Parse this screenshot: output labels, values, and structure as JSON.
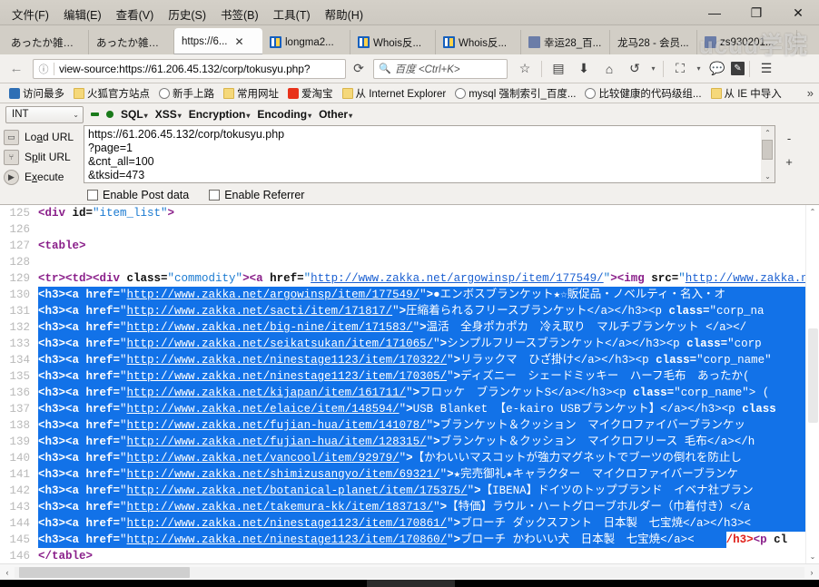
{
  "window": {
    "menu": [
      "文件(F)",
      "编辑(E)",
      "查看(V)",
      "历史(S)",
      "书签(B)",
      "工具(T)",
      "帮助(H)"
    ],
    "controls": {
      "minimize": "—",
      "maximize": "❐",
      "close": "✕"
    }
  },
  "tabs": [
    {
      "label": "あったか雑貨...",
      "favicon": "none",
      "active": false,
      "closable": false
    },
    {
      "label": "あったか雑貨...",
      "favicon": "none",
      "active": false,
      "closable": false
    },
    {
      "label": "https://6...",
      "favicon": "none",
      "active": true,
      "closable": true
    },
    {
      "label": "longma2...",
      "favicon": "blue",
      "active": false,
      "closable": false
    },
    {
      "label": "Whois反...",
      "favicon": "blue",
      "active": false,
      "closable": false
    },
    {
      "label": "Whois反...",
      "favicon": "blue",
      "active": false,
      "closable": false
    },
    {
      "label": "幸运28_百...",
      "favicon": "grey",
      "active": false,
      "closable": false
    },
    {
      "label": "龙马28 - 会员...",
      "favicon": "none",
      "active": false,
      "closable": false
    },
    {
      "label": "zs930201...",
      "favicon": "grey",
      "active": false,
      "closable": false
    }
  ],
  "nav": {
    "back_icon": "back-arrow-icon",
    "info_icon": "ⓘ",
    "url": "view-source:https://61.206.45.132/corp/tokusyu.php?",
    "reload_icon": "⟳",
    "search_placeholder": "百度 <Ctrl+K>",
    "icons": [
      "bookmark-star-icon",
      "reader-icon",
      "download-icon",
      "home-icon",
      "undo-icon",
      "screenshot-icon",
      "chat-icon",
      "edit-icon",
      "menu-icon"
    ]
  },
  "bookmarks": [
    {
      "label": "访问最多",
      "icon": "blue"
    },
    {
      "label": "火狐官方站点",
      "icon": "folder"
    },
    {
      "label": "新手上路",
      "icon": "globe"
    },
    {
      "label": "常用网址",
      "icon": "folder"
    },
    {
      "label": "爱淘宝",
      "icon": "red"
    },
    {
      "label": "从 Internet Explorer",
      "icon": "folder"
    },
    {
      "label": "mysql 强制索引_百度...",
      "icon": "globe"
    },
    {
      "label": "比较健康的代码级组...",
      "icon": "globe"
    },
    {
      "label": "从 IE 中导入",
      "icon": "folder"
    }
  ],
  "bookmarks_overflow": "»",
  "hackbar": {
    "select_value": "INT",
    "select_chevron": "⌄",
    "menus": [
      "SQL",
      "XSS",
      "Encryption",
      "Encoding",
      "Other"
    ],
    "menu_caret": "▾",
    "actions": [
      {
        "label_pre": "Lo",
        "label_key": "a",
        "label_post": "d URL",
        "icon": "load-url-icon"
      },
      {
        "label_pre": "S",
        "label_key": "p",
        "label_post": "lit URL",
        "icon": "split-url-icon"
      },
      {
        "label_pre": "E",
        "label_key": "x",
        "label_post": "ecute",
        "icon": "execute-icon"
      }
    ],
    "url_value": "https://61.206.45.132/corp/tokusyu.php\n?page=1\n&cnt_all=100\n&tksid=473",
    "checkbox_post": "Enable Post data",
    "checkbox_referrer": "Enable Referrer",
    "zoom_plus": "+",
    "zoom_minus": "-"
  },
  "source": {
    "lines": [
      {
        "n": "125",
        "selected": false,
        "parts": [
          {
            "c": "t",
            "s": "<div "
          },
          {
            "c": "a",
            "s": "id="
          },
          {
            "c": "v",
            "s": "\"item_list\""
          },
          {
            "c": "t",
            "s": ">"
          }
        ]
      },
      {
        "n": "126",
        "selected": false,
        "parts": []
      },
      {
        "n": "127",
        "selected": false,
        "parts": [
          {
            "c": "t",
            "s": "<table>"
          }
        ]
      },
      {
        "n": "128",
        "selected": false,
        "parts": []
      },
      {
        "n": "129",
        "selected": false,
        "parts": [
          {
            "c": "t",
            "s": "<tr><td><div "
          },
          {
            "c": "a",
            "s": "class="
          },
          {
            "c": "v",
            "s": "\"commodity\""
          },
          {
            "c": "t",
            "s": "><a "
          },
          {
            "c": "a",
            "s": "href="
          },
          {
            "c": "v",
            "s": "\""
          },
          {
            "c": "u",
            "s": "http://www.zakka.net/argowinsp/item/177549/"
          },
          {
            "c": "v",
            "s": "\""
          },
          {
            "c": "t",
            "s": "><img "
          },
          {
            "c": "a",
            "s": "src="
          },
          {
            "c": "v",
            "s": "\""
          },
          {
            "c": "u",
            "s": "http://www.zakka.ne"
          }
        ]
      },
      {
        "n": "130",
        "selected": true,
        "parts": [
          {
            "c": "t",
            "s": "<h3><a "
          },
          {
            "c": "a",
            "s": "href="
          },
          {
            "c": "v",
            "s": "\""
          },
          {
            "c": "u",
            "s": "http://www.zakka.net/argowinsp/item/177549/"
          },
          {
            "c": "v",
            "s": "\""
          },
          {
            "c": "t",
            "s": ">"
          },
          {
            "c": "txt",
            "s": "●エンボスブランケット★☆販促品・ノベルティ・名入・オ"
          }
        ]
      },
      {
        "n": "131",
        "selected": true,
        "parts": [
          {
            "c": "t",
            "s": "<h3><a "
          },
          {
            "c": "a",
            "s": "href="
          },
          {
            "c": "v",
            "s": "\""
          },
          {
            "c": "u",
            "s": "http://www.zakka.net/sacti/item/171817/"
          },
          {
            "c": "v",
            "s": "\""
          },
          {
            "c": "t",
            "s": ">"
          },
          {
            "c": "txt",
            "s": "圧縮着られるフリースブランケット</a></h3><p "
          },
          {
            "c": "a",
            "s": "class="
          },
          {
            "c": "v",
            "s": "\"corp_na"
          }
        ]
      },
      {
        "n": "132",
        "selected": true,
        "parts": [
          {
            "c": "t",
            "s": "<h3><a "
          },
          {
            "c": "a",
            "s": "href="
          },
          {
            "c": "v",
            "s": "\""
          },
          {
            "c": "u",
            "s": "http://www.zakka.net/big-nine/item/171583/"
          },
          {
            "c": "v",
            "s": "\""
          },
          {
            "c": "t",
            "s": ">"
          },
          {
            "c": "txt",
            "s": "温活　全身ポカポカ　冷え取り　マルチブランケット </a></"
          }
        ]
      },
      {
        "n": "133",
        "selected": true,
        "parts": [
          {
            "c": "t",
            "s": "<h3><a "
          },
          {
            "c": "a",
            "s": "href="
          },
          {
            "c": "v",
            "s": "\""
          },
          {
            "c": "u",
            "s": "http://www.zakka.net/seikatsukan/item/171065/"
          },
          {
            "c": "v",
            "s": "\""
          },
          {
            "c": "t",
            "s": ">"
          },
          {
            "c": "txt",
            "s": "シンプルフリースブランケット</a></h3><p "
          },
          {
            "c": "a",
            "s": "class="
          },
          {
            "c": "v",
            "s": "\"corp"
          }
        ]
      },
      {
        "n": "134",
        "selected": true,
        "parts": [
          {
            "c": "t",
            "s": "<h3><a "
          },
          {
            "c": "a",
            "s": "href="
          },
          {
            "c": "v",
            "s": "\""
          },
          {
            "c": "u",
            "s": "http://www.zakka.net/ninestage1123/item/170322/"
          },
          {
            "c": "v",
            "s": "\""
          },
          {
            "c": "t",
            "s": ">"
          },
          {
            "c": "txt",
            "s": "リラックマ　ひざ掛け</a></h3><p "
          },
          {
            "c": "a",
            "s": "class="
          },
          {
            "c": "v",
            "s": "\"corp_name\""
          }
        ]
      },
      {
        "n": "135",
        "selected": true,
        "parts": [
          {
            "c": "t",
            "s": "<h3><a "
          },
          {
            "c": "a",
            "s": "href="
          },
          {
            "c": "v",
            "s": "\""
          },
          {
            "c": "u",
            "s": "http://www.zakka.net/ninestage1123/item/170305/"
          },
          {
            "c": "v",
            "s": "\""
          },
          {
            "c": "t",
            "s": ">"
          },
          {
            "c": "txt",
            "s": "ディズニー　シェードミッキー　ハーフ毛布　あったか("
          }
        ]
      },
      {
        "n": "136",
        "selected": true,
        "parts": [
          {
            "c": "t",
            "s": "<h3><a "
          },
          {
            "c": "a",
            "s": "href="
          },
          {
            "c": "v",
            "s": "\""
          },
          {
            "c": "u",
            "s": "http://www.zakka.net/kijapan/item/161711/"
          },
          {
            "c": "v",
            "s": "\""
          },
          {
            "c": "t",
            "s": ">"
          },
          {
            "c": "txt",
            "s": "フロッケ　ブランケットS</a></h3><p "
          },
          {
            "c": "a",
            "s": "class="
          },
          {
            "c": "v",
            "s": "\"corp_name\""
          },
          {
            "c": "txt",
            "s": "> ("
          }
        ]
      },
      {
        "n": "137",
        "selected": true,
        "parts": [
          {
            "c": "t",
            "s": "<h3><a "
          },
          {
            "c": "a",
            "s": "href="
          },
          {
            "c": "v",
            "s": "\""
          },
          {
            "c": "u",
            "s": "http://www.zakka.net/elaice/item/148594/"
          },
          {
            "c": "v",
            "s": "\""
          },
          {
            "c": "t",
            "s": ">"
          },
          {
            "c": "txt",
            "s": "USB Blanket 【e-kairo USBブランケット】</a></h3><p "
          },
          {
            "c": "a",
            "s": "class"
          }
        ]
      },
      {
        "n": "138",
        "selected": true,
        "parts": [
          {
            "c": "t",
            "s": "<h3><a "
          },
          {
            "c": "a",
            "s": "href="
          },
          {
            "c": "v",
            "s": "\""
          },
          {
            "c": "u",
            "s": "http://www.zakka.net/fujian-hua/item/141078/"
          },
          {
            "c": "v",
            "s": "\""
          },
          {
            "c": "t",
            "s": ">"
          },
          {
            "c": "txt",
            "s": "ブランケット＆クッション　マイクロファイバーブランケッ"
          }
        ]
      },
      {
        "n": "139",
        "selected": true,
        "parts": [
          {
            "c": "t",
            "s": "<h3><a "
          },
          {
            "c": "a",
            "s": "href="
          },
          {
            "c": "v",
            "s": "\""
          },
          {
            "c": "u",
            "s": "http://www.zakka.net/fujian-hua/item/128315/"
          },
          {
            "c": "v",
            "s": "\""
          },
          {
            "c": "t",
            "s": ">"
          },
          {
            "c": "txt",
            "s": "ブランケット＆クッション　マイクロフリース 毛布</a></h"
          }
        ]
      },
      {
        "n": "140",
        "selected": true,
        "parts": [
          {
            "c": "t",
            "s": "<h3><a "
          },
          {
            "c": "a",
            "s": "href="
          },
          {
            "c": "v",
            "s": "\""
          },
          {
            "c": "u",
            "s": "http://www.zakka.net/vancool/item/92979/"
          },
          {
            "c": "v",
            "s": "\""
          },
          {
            "c": "t",
            "s": ">"
          },
          {
            "c": "txt",
            "s": "【かわいいマスコットが強力マグネットでブーツの倒れを防止し"
          }
        ]
      },
      {
        "n": "141",
        "selected": true,
        "parts": [
          {
            "c": "t",
            "s": "<h3><a "
          },
          {
            "c": "a",
            "s": "href="
          },
          {
            "c": "v",
            "s": "\""
          },
          {
            "c": "u",
            "s": "http://www.zakka.net/shimizusangyo/item/69321/"
          },
          {
            "c": "v",
            "s": "\""
          },
          {
            "c": "t",
            "s": ">"
          },
          {
            "c": "txt",
            "s": "★完売御礼★キャラクター　マイクロファイバーブランケ"
          }
        ]
      },
      {
        "n": "142",
        "selected": true,
        "parts": [
          {
            "c": "t",
            "s": "<h3><a "
          },
          {
            "c": "a",
            "s": "href="
          },
          {
            "c": "v",
            "s": "\""
          },
          {
            "c": "u",
            "s": "http://www.zakka.net/botanical-planet/item/175375/"
          },
          {
            "c": "v",
            "s": "\""
          },
          {
            "c": "t",
            "s": ">"
          },
          {
            "c": "txt",
            "s": "【IBENA】ドイツのトップブランド　イベナ社ブラン"
          }
        ]
      },
      {
        "n": "143",
        "selected": true,
        "parts": [
          {
            "c": "t",
            "s": "<h3><a "
          },
          {
            "c": "a",
            "s": "href="
          },
          {
            "c": "v",
            "s": "\""
          },
          {
            "c": "u",
            "s": "http://www.zakka.net/takemura-kk/item/183713/"
          },
          {
            "c": "v",
            "s": "\""
          },
          {
            "c": "t",
            "s": ">"
          },
          {
            "c": "txt",
            "s": "【特価】ラウル・ハートグローブホルダー（巾着付き）</a"
          }
        ]
      },
      {
        "n": "144",
        "selected": true,
        "parts": [
          {
            "c": "t",
            "s": "<h3><a "
          },
          {
            "c": "a",
            "s": "href="
          },
          {
            "c": "v",
            "s": "\""
          },
          {
            "c": "u",
            "s": "http://www.zakka.net/ninestage1123/item/170861/"
          },
          {
            "c": "v",
            "s": "\""
          },
          {
            "c": "t",
            "s": ">"
          },
          {
            "c": "txt",
            "s": "ブローチ ダックスフント　日本製　七宝焼</a></h3><"
          }
        ]
      },
      {
        "n": "145",
        "selected": true,
        "selection_ends": true,
        "parts": [
          {
            "c": "t",
            "s": "<h3><a "
          },
          {
            "c": "a",
            "s": "href="
          },
          {
            "c": "v",
            "s": "\""
          },
          {
            "c": "u",
            "s": "http://www.zakka.net/ninestage1123/item/170860/"
          },
          {
            "c": "v",
            "s": "\""
          },
          {
            "c": "t",
            "s": ">"
          },
          {
            "c": "txt",
            "s": "ブローチ かわいい犬　日本製　七宝焼</a><"
          }
        ],
        "tail": [
          {
            "c": "red",
            "s": "/h3>"
          },
          {
            "c": "t",
            "s": "<p "
          },
          {
            "c": "a",
            "s": "cl"
          }
        ]
      },
      {
        "n": "146",
        "selected": false,
        "parts": [
          {
            "c": "t",
            "s": "</table>"
          }
        ]
      }
    ]
  },
  "scrollbars": {
    "v_up": "⌃",
    "v_down": "⌄",
    "h_left": "‹",
    "h_right": "›"
  },
  "watermark": "ucuu学院",
  "colors": {
    "selection": "#1272e8",
    "tag": "#8a1f8a",
    "attr_value": "#1a7ad1",
    "link": "#1a5fd1",
    "error": "#e0201a",
    "chrome": "#f2f0ed"
  }
}
